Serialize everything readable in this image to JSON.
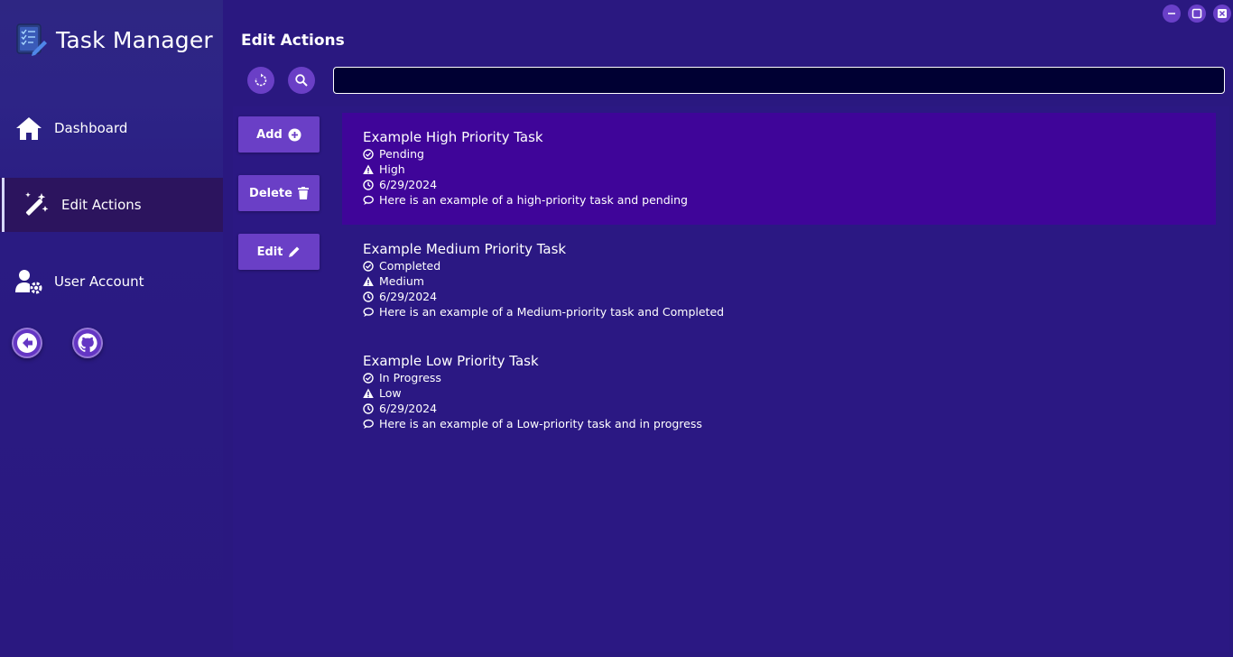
{
  "app": {
    "title": "Task Manager"
  },
  "sidebar": {
    "items": [
      {
        "label": "Dashboard",
        "icon": "home-icon"
      },
      {
        "label": "Edit Actions",
        "icon": "magic-wand-icon",
        "active": true
      },
      {
        "label": "User Account",
        "icon": "user-gear-icon"
      }
    ],
    "footer_buttons": [
      {
        "icon": "back-arrow-icon"
      },
      {
        "icon": "github-icon"
      }
    ]
  },
  "window_controls": [
    "minimize",
    "maximize",
    "close"
  ],
  "page": {
    "title": "Edit Actions"
  },
  "toolbar": {
    "refresh_icon": "refresh-icon",
    "search_icon": "search-icon",
    "search_value": "",
    "search_placeholder": ""
  },
  "actions": {
    "add_label": "Add",
    "delete_label": "Delete",
    "edit_label": "Edit"
  },
  "tasks": [
    {
      "title": "Example High Priority Task",
      "status": "Pending",
      "priority": "High",
      "date": "6/29/2024",
      "description": "Here is an example of a high-priority task and pending",
      "selected": true
    },
    {
      "title": "Example Medium Priority Task",
      "status": "Completed",
      "priority": "Medium",
      "date": "6/29/2024",
      "description": "Here is an example of a Medium-priority task and Completed"
    },
    {
      "title": "Example Low Priority Task",
      "status": "In Progress",
      "priority": "Low",
      "date": "6/29/2024",
      "description": "Here is an example of a Low-priority task and in progress"
    }
  ],
  "colors": {
    "background": "#2a1880",
    "sidebar_active": "#2c145e",
    "accent": "#6a3fc6",
    "selected_task": "#3f0599",
    "search_bg": "#000033"
  }
}
